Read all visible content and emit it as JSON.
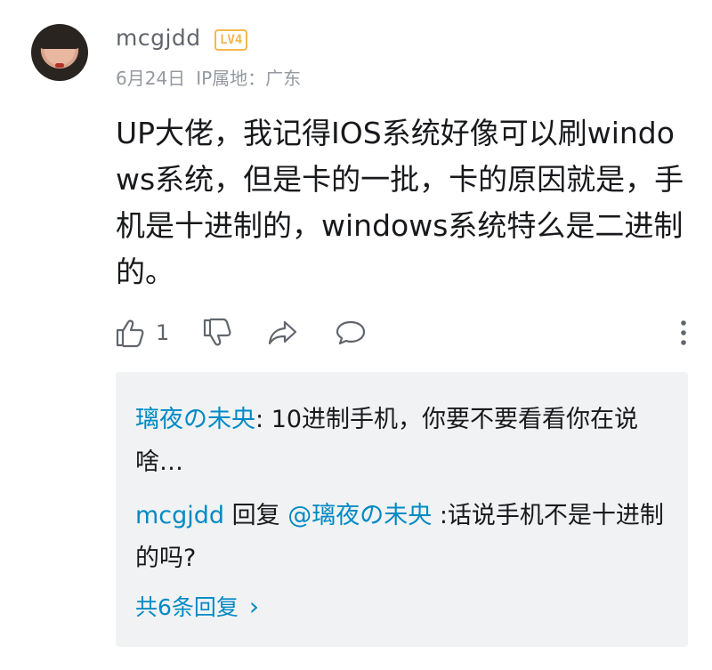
{
  "comment": {
    "username": "mcgjdd",
    "level_badge": "LV4",
    "date": "6月24日",
    "ip_location": "IP属地：广东",
    "text": "UP大佬，我记得IOS系统好像可以刷windows系统，但是卡的一批，卡的原因就是，手机是十进制的，windows系统特么是二进制的。",
    "like_count": "1"
  },
  "replies": [
    {
      "author": "璃夜の未央",
      "separator": ": ",
      "text": "10进制手机，你要不要看看你在说啥…"
    },
    {
      "author": "mcgjdd",
      "reply_word": " 回复 ",
      "mention": "@璃夜の未央",
      "text": " :话说手机不是十进制的吗?"
    }
  ],
  "total_replies": "共6条回复",
  "icons": {
    "like": "thumbs-up-icon",
    "dislike": "thumbs-down-icon",
    "share": "share-icon",
    "reply": "comment-icon",
    "more": "more-vertical-icon",
    "chevron": "chevron-right-icon"
  },
  "colors": {
    "link": "#008ac5",
    "level": "#f5b750",
    "meta": "#9499a0"
  }
}
